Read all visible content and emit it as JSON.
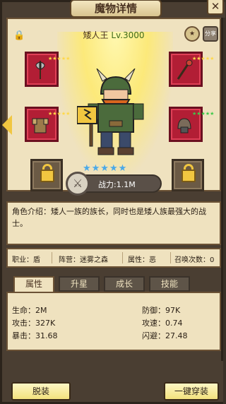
{
  "title": "魔物详情",
  "close_label": "✕",
  "hero": {
    "name": "矮人王",
    "level": "Lv.3000",
    "power": "战力:1.1M",
    "stars": "★★★★★"
  },
  "top_icons": {
    "left": "🔒",
    "right1": "★",
    "right2": "分享"
  },
  "description": "角色介绍：矮人一族的族长，同时也是矮人族最强大的战士。",
  "info": {
    "job_label": "职业：盾",
    "camp_label": "阵营：迷雾之森",
    "attr_label": "属性：恶",
    "summon_label": "召唤次数：0"
  },
  "tabs": [
    {
      "label": "属性"
    },
    {
      "label": "升星"
    },
    {
      "label": "成长"
    },
    {
      "label": "技能"
    }
  ],
  "stats": {
    "hp": "生命：2M",
    "attack": "攻击：327K",
    "crit": "暴击：31.68",
    "defense": "防御：97K",
    "atk_speed": "攻速：0.74",
    "dodge": "闪避：27.48"
  },
  "buttons": {
    "unequip": "脱装",
    "equip_all": "一键穿装"
  },
  "colors": {
    "equip_red": "#b21e35",
    "star_gold": "#ffd84a",
    "star_green": "#3ec94a",
    "hero_star_blue": "#4aa9e8",
    "button_yellow": "#f3e27e"
  }
}
